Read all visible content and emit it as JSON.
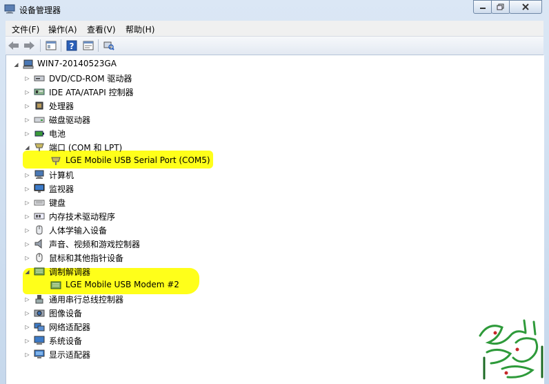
{
  "window": {
    "title": "设备管理器"
  },
  "menu": [
    "文件(F)",
    "操作(A)",
    "查看(V)",
    "帮助(H)"
  ],
  "tree": {
    "root": "WIN7-20140523GA",
    "items": [
      {
        "label": "DVD/CD-ROM 驱动器",
        "icon": "dvd-drive-icon"
      },
      {
        "label": "IDE ATA/ATAPI 控制器",
        "icon": "ide-controller-icon"
      },
      {
        "label": "处理器",
        "icon": "processor-icon"
      },
      {
        "label": "磁盘驱动器",
        "icon": "disk-drive-icon"
      },
      {
        "label": "电池",
        "icon": "battery-icon"
      },
      {
        "label": "端口 (COM 和 LPT)",
        "icon": "port-icon",
        "expanded": true
      },
      {
        "label": "LGE Mobile USB Serial Port (COM5)",
        "icon": "port-icon",
        "child": true
      },
      {
        "label": "计算机",
        "icon": "computer-icon"
      },
      {
        "label": "监视器",
        "icon": "monitor-icon"
      },
      {
        "label": "键盘",
        "icon": "keyboard-icon"
      },
      {
        "label": "内存技术驱动程序",
        "icon": "memory-icon"
      },
      {
        "label": "人体学输入设备",
        "icon": "hid-icon"
      },
      {
        "label": "声音、视频和游戏控制器",
        "icon": "speaker-icon"
      },
      {
        "label": "鼠标和其他指针设备",
        "icon": "mouse-icon"
      },
      {
        "label": "调制解调器",
        "icon": "modem-icon",
        "expanded": true
      },
      {
        "label": "LGE Mobile USB Modem #2",
        "icon": "modem-icon",
        "child": true
      },
      {
        "label": "通用串行总线控制器",
        "icon": "usb-icon"
      },
      {
        "label": "图像设备",
        "icon": "camera-icon"
      },
      {
        "label": "网络适配器",
        "icon": "network-icon"
      },
      {
        "label": "系统设备",
        "icon": "system-icon"
      },
      {
        "label": "显示适配器",
        "icon": "display-icon"
      }
    ]
  },
  "colors": {
    "highlight": "#ffff1a",
    "chrome": "#c9dbee",
    "watermark_green": "#2e9a3a"
  }
}
